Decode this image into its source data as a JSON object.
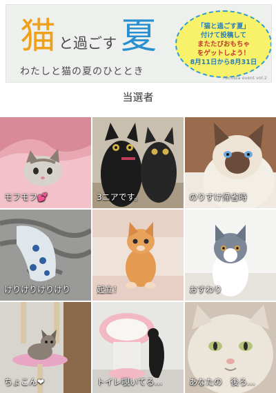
{
  "banner": {
    "brand_cat": "猫",
    "brand_mid": "と過ごす",
    "brand_summer": "夏",
    "tagline": "わたしと猫の夏のひととき",
    "bubble_lines": [
      "「猫と過ごす夏」",
      "付けて投稿して",
      "またたびおもちゃ",
      "をゲットしよう！",
      "8月11日から8月31日"
    ],
    "footnote": "necosta event vol.2"
  },
  "section_title": "当選者",
  "winners": [
    {
      "caption": "モフモフ💕",
      "photo": "cat-under-pink-blanket-photo"
    },
    {
      "caption": "3ニアです。",
      "photo": "black-kittens-photo"
    },
    {
      "caption": "のりすけ帰省時",
      "photo": "siamese-cat-photo"
    },
    {
      "caption": "けりけりけりけり",
      "photo": "tabby-cat-with-sock-photo"
    },
    {
      "caption": "起立！",
      "photo": "orange-kitten-standing-photo"
    },
    {
      "caption": "おすわり",
      "photo": "grey-white-kitten-photo"
    },
    {
      "caption": "ちょこん❤",
      "photo": "kitten-on-cat-tower-photo"
    },
    {
      "caption": "トイレ覗いてる…",
      "photo": "cat-peeking-toilet-photo"
    },
    {
      "caption": "あなたの　後ろ…",
      "photo": "white-cat-closeup-photo"
    }
  ]
}
